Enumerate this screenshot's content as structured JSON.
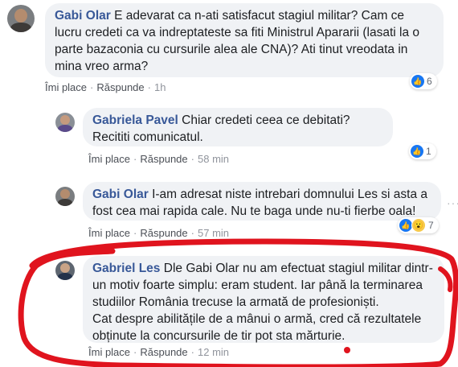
{
  "comments": [
    {
      "author": "Gabi Olar",
      "text": "E adevarat ca n-ati satisfacut stagiul militar? Cam ce lucru credeti ca va indreptateste sa fiti Ministrul Apararii (lasati la o parte bazaconia cu cursurile alea ale CNA)? Ati tinut vreodata in mina vreo arma?",
      "like_label": "Îmi place",
      "reply_label": "Răspunde",
      "time": "1h",
      "reaction_count": "6"
    },
    {
      "author": "Gabriela Pavel",
      "text": "Chiar credeti ceea ce debitati? Recititi comunicatul.",
      "like_label": "Îmi place",
      "reply_label": "Răspunde",
      "time": "58 min",
      "reaction_count": "1"
    },
    {
      "author": "Gabi Olar",
      "text": "I-am adresat niste intrebari domnului Les si asta a fost cea mai rapida cale. Nu te baga unde nu-ti fierbe oala!",
      "like_label": "Îmi place",
      "reply_label": "Răspunde",
      "time": "57 min",
      "reaction_count": "7"
    },
    {
      "author": "Gabriel Les",
      "text_lines": [
        "Dle Gabi Olar nu am efectuat stagiul militar dintr-",
        "un motiv foarte simplu: eram student. Iar până la terminarea",
        "studiilor România trecuse la armată de profesioniști.",
        "Cat despre abilitățile de a mânui o armă, cred că rezultatele",
        "obținute la concursurile de tir pot sta mărturie."
      ],
      "like_label": "Îmi place",
      "reply_label": "Răspunde",
      "time": "12 min"
    }
  ],
  "colors": {
    "name": "#385898",
    "bubble": "#f0f2f5",
    "like": "#1877f2",
    "annotation": "#e0141e"
  }
}
